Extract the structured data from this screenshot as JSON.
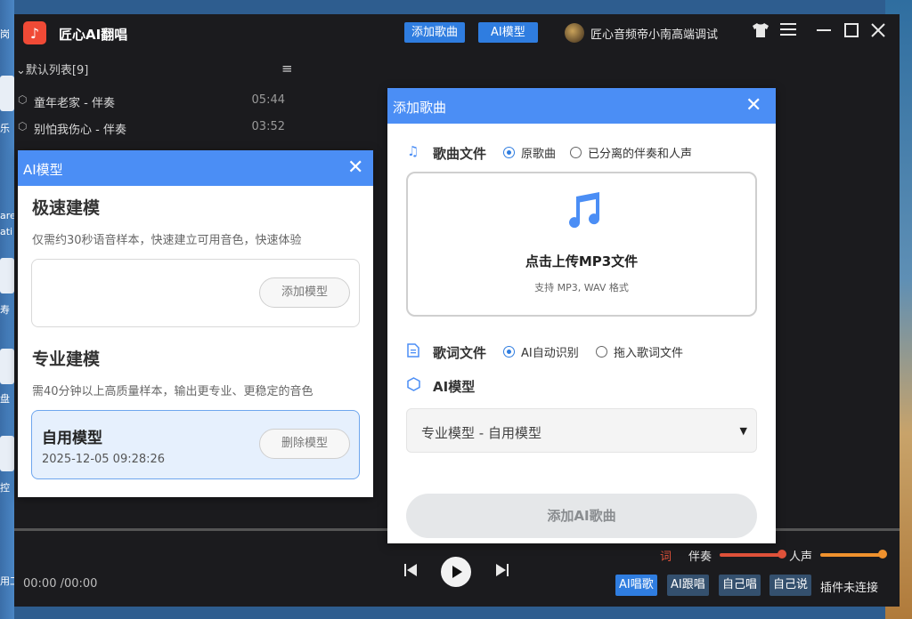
{
  "desktop": {
    "icon_labels": [
      "岗",
      "乐",
      "are",
      "ati",
      "寿",
      "盘",
      "控",
      "用工"
    ]
  },
  "app": {
    "title": "匠心AI翻唱",
    "logo_glyph": "♪",
    "buttons": {
      "add_song": "添加歌曲",
      "ai_model": "AI模型"
    },
    "user": {
      "name": "匠心音频帝小南高端调试"
    }
  },
  "playlist": {
    "header": "默认列表[9]",
    "songs": [
      {
        "title": "童年老家 - 伴奏",
        "duration": "05:44"
      },
      {
        "title": "别怕我伤心 - 伴奏",
        "duration": "03:52"
      }
    ]
  },
  "player": {
    "time": "00:00 /00:00",
    "lyric_tag": "词",
    "accompaniment_label": "伴奏",
    "vocal_label": "人声",
    "accompaniment_level": 1.0,
    "vocal_level": 1.0,
    "modes": [
      "AI唱歌",
      "AI跟唱",
      "自己唱",
      "自己说"
    ],
    "plugin_status": "插件未连接"
  },
  "ai_model_dialog": {
    "title": "AI模型",
    "fast": {
      "title": "极速建模",
      "desc": "仅需约30秒语音样本，快速建立可用音色，快速体验",
      "add_button": "添加模型"
    },
    "pro": {
      "title": "专业建模",
      "desc": "需40分钟以上高质量样本，输出更专业、更稳定的音色"
    },
    "model": {
      "name": "自用模型",
      "date": "2025-12-05 09:28:26",
      "delete_button": "删除模型"
    }
  },
  "add_song_dialog": {
    "title": "添加歌曲",
    "song_file": {
      "label": "歌曲文件",
      "option_original": "原歌曲",
      "option_separated": "已分离的伴奏和人声"
    },
    "upload": {
      "text": "点击上传MP3文件",
      "sub": "支持 MP3, WAV 格式"
    },
    "lyric_file": {
      "label": "歌词文件",
      "option_auto": "AI自动识别",
      "option_drag": "拖入歌词文件"
    },
    "ai_model": {
      "label": "AI模型",
      "selected": "专业模型 - 自用模型"
    },
    "submit": "添加AI歌曲"
  },
  "colors": {
    "accent": "#4b8ef5",
    "brand_red": "#f04a36",
    "button_blue": "#2f7de0",
    "slider_red": "#e0523a",
    "slider_orange": "#f0922e"
  }
}
